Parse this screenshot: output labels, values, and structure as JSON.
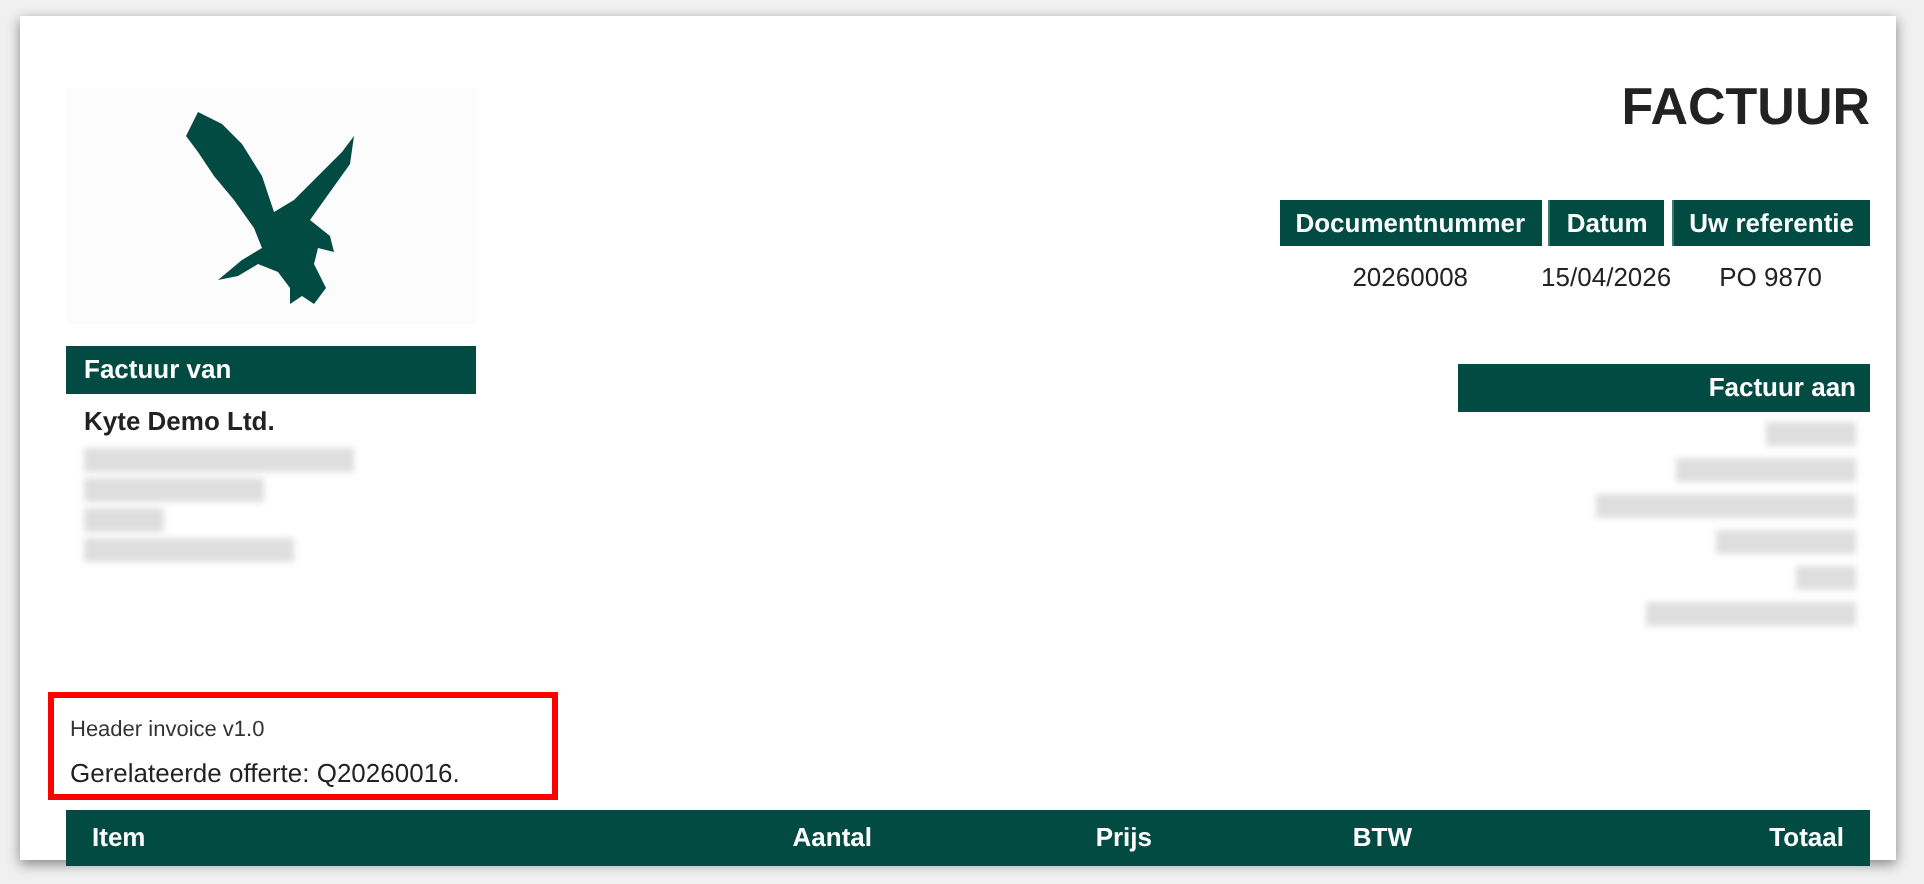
{
  "title": "FACTUUR",
  "meta_table": {
    "columns": [
      "Documentnummer",
      "Datum",
      "Uw referentie"
    ],
    "values": [
      "20260008",
      "15/04/2026",
      "PO 9870"
    ]
  },
  "sender": {
    "heading": "Factuur van",
    "name": "Kyte Demo Ltd."
  },
  "recipient": {
    "heading": "Factuur aan"
  },
  "notes": {
    "highlighted": true,
    "lines": [
      "Header invoice v1.0",
      "Gerelateerde offerte: Q20260016."
    ]
  },
  "items_table": {
    "columns": [
      "Item",
      "Aantal",
      "Prijs",
      "BTW",
      "Totaal"
    ]
  }
}
